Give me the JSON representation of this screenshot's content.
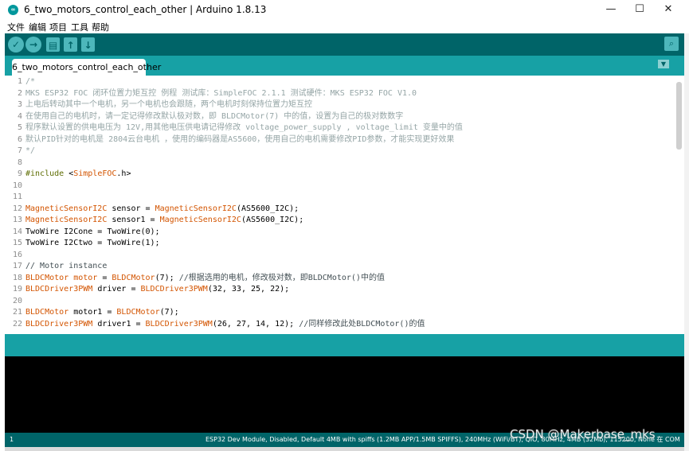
{
  "window": {
    "title": "6_two_motors_control_each_other | Arduino 1.8.13",
    "minimize": "—",
    "maximize": "☐",
    "close": "✕"
  },
  "menu": [
    "文件",
    "编辑",
    "项目",
    "工具",
    "帮助"
  ],
  "toolbar": {
    "verify_icon": "check-icon",
    "upload_icon": "arrow-right-icon",
    "new_icon": "new-file-icon",
    "open_icon": "arrow-up-icon",
    "save_icon": "arrow-down-icon",
    "serial_monitor_icon": "magnifier-icon"
  },
  "tab": {
    "label": "6_two_motors_control_each_other"
  },
  "code_lines": [
    {
      "n": "1",
      "t": "/*"
    },
    {
      "n": "2",
      "t": "MKS ESP32 FOC 闭环位置力矩互控 例程 测试库：SimpleFOC 2.1.1 测试硬件：MKS ESP32 FOC V1.0"
    },
    {
      "n": "3",
      "t": "上电后转动其中一个电机，另一个电机也会跟随，两个电机时刻保持位置力矩互控"
    },
    {
      "n": "4",
      "t": "在使用自己的电机时，请一定记得修改默认极对数，即 BLDCMotor(7) 中的值，设置为自己的极对数数字"
    },
    {
      "n": "5",
      "t": "程序默认设置的供电电压为 12V,用其他电压供电请记得修改 voltage_power_supply , voltage_limit 变量中的值"
    },
    {
      "n": "6",
      "t": "默认PID针对的电机是 2804云台电机 ，使用的编码器是AS5600，使用自己的电机需要修改PID参数，才能实现更好效果"
    },
    {
      "n": "7",
      "t": " */"
    },
    {
      "n": "8",
      "t": ""
    },
    {
      "n": "9",
      "t": "#include <SimpleFOC.h>"
    },
    {
      "n": "10",
      "t": ""
    },
    {
      "n": "11",
      "t": ""
    },
    {
      "n": "12",
      "t": "MagneticSensorI2C sensor = MagneticSensorI2C(AS5600_I2C);"
    },
    {
      "n": "13",
      "t": "MagneticSensorI2C sensor1 = MagneticSensorI2C(AS5600_I2C);"
    },
    {
      "n": "14",
      "t": "TwoWire I2Cone = TwoWire(0);"
    },
    {
      "n": "15",
      "t": "TwoWire I2Ctwo = TwoWire(1);"
    },
    {
      "n": "16",
      "t": ""
    },
    {
      "n": "17",
      "t": "// Motor instance"
    },
    {
      "n": "18",
      "t": "BLDCMotor motor = BLDCMotor(7);                                  //根据选用的电机，修改极对数，即BLDCMotor()中的值"
    },
    {
      "n": "19",
      "t": "BLDCDriver3PWM driver = BLDCDriver3PWM(32, 33, 25, 22);"
    },
    {
      "n": "20",
      "t": ""
    },
    {
      "n": "21",
      "t": "BLDCMotor motor1 = BLDCMotor(7);"
    },
    {
      "n": "22",
      "t": "BLDCDriver3PWM driver1 = BLDCDriver3PWM(26, 27, 14, 12);     //同样修改此处BLDCMotor()的值"
    }
  ],
  "status": {
    "line": "1",
    "board": "ESP32 Dev Module, Disabled, Default 4MB with spiffs (1.2MB APP/1.5MB SPIFFS), 240MHz (WiFi/BT), QIO, 80MHz, 4MB (32Mb), 115200, None 在 COM"
  },
  "watermark": "CSDN @Makerbase_mks",
  "colors": {
    "teal_dark": "#006468",
    "teal": "#17a1a5",
    "keyword": "#d35400",
    "comment": "#95a5a6"
  }
}
